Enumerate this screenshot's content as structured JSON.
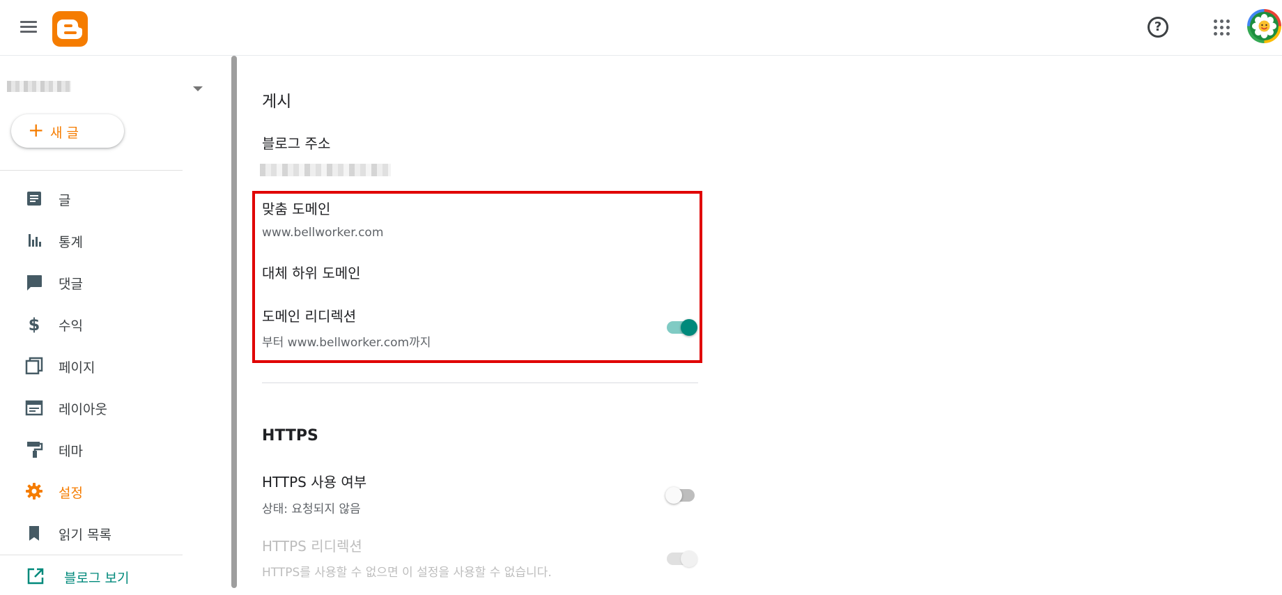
{
  "header": {
    "menu_icon": "hamburger-menu-icon",
    "logo_icon": "blogger-logo-icon",
    "help_glyph": "?",
    "help_icon": "help-icon",
    "apps_icon": "apps-grid-icon",
    "avatar_icon": "flower-avatar"
  },
  "sidebar": {
    "new_post_label": "새 글",
    "items": [
      {
        "label": "글",
        "icon": "posts-icon"
      },
      {
        "label": "통계",
        "icon": "stats-icon"
      },
      {
        "label": "댓글",
        "icon": "comments-icon"
      },
      {
        "label": "수익",
        "icon": "dollar-icon"
      },
      {
        "label": "페이지",
        "icon": "pages-icon"
      },
      {
        "label": "레이아웃",
        "icon": "layout-icon"
      },
      {
        "label": "테마",
        "icon": "theme-roller-icon"
      },
      {
        "label": "설정",
        "icon": "gear-icon",
        "active": true
      },
      {
        "label": "읽기 목록",
        "icon": "bookmark-icon"
      }
    ],
    "view_blog_label": "블로그 보기"
  },
  "main": {
    "publish_section": {
      "title": "게시",
      "blog_address_title": "블로그 주소",
      "custom_domain_title": "맞춤 도메인",
      "custom_domain_value": "www.bellworker.com",
      "fallback_subdomain_title": "대체 하위 도메인",
      "domain_redirect_title": "도메인 리디렉션",
      "domain_redirect_sub": "부터 www.bellworker.com까지",
      "domain_redirect_on": true
    },
    "https_section": {
      "title": "HTTPS",
      "https_availability_title": "HTTPS 사용 여부",
      "https_availability_sub": "상태: 요청되지 않음",
      "https_availability_on": false,
      "https_redirect_title": "HTTPS 리디렉션",
      "https_redirect_sub": "HTTPS를 사용할 수 없으면 이 설정을 사용할 수 없습니다.",
      "https_redirect_disabled": true
    }
  },
  "colors": {
    "accent": "#f57c00",
    "toggle_on": "#00897b",
    "highlight": "#e00000",
    "link": "#00897b"
  }
}
